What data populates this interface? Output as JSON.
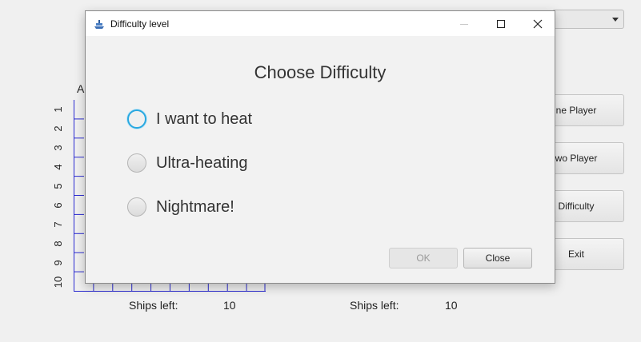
{
  "main": {
    "side_buttons": [
      "ne Player",
      "wo Player",
      "Difficulty",
      "Exit"
    ],
    "column_letter": "A",
    "row_numbers": [
      "1",
      "2",
      "3",
      "4",
      "5",
      "6",
      "7",
      "8",
      "9",
      "10"
    ],
    "left_ships_label": "Ships left:",
    "left_ships_value": "10",
    "right_ships_label": "Ships left:",
    "right_ships_value": "10"
  },
  "dialog": {
    "title": "Difficulty level",
    "heading": "Choose Difficulty",
    "options": [
      "I want to heat",
      "Ultra-heating",
      "Nightmare!"
    ],
    "ok_label": "OK",
    "close_label": "Close"
  },
  "colors": {
    "grid_line": "#2a2ad0",
    "focus_ring": "#29a8e0"
  }
}
